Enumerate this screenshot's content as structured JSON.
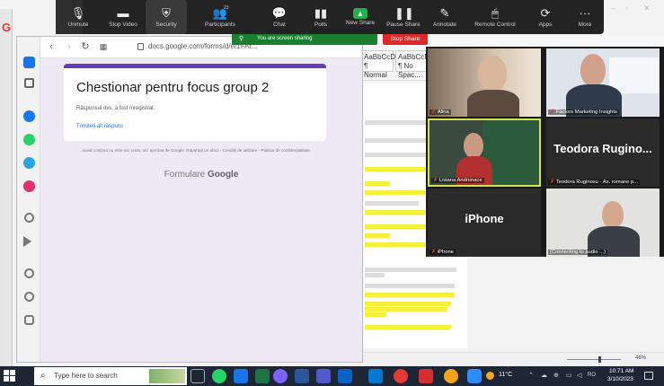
{
  "zoom_toolbar": {
    "logo": "G",
    "participant_count": "23",
    "items": [
      {
        "label": "Unmute",
        "icon": "mic-muted-icon"
      },
      {
        "label": "Stop Video",
        "icon": "video-icon"
      },
      {
        "label": "Security",
        "icon": "shield-icon"
      },
      {
        "label": "Participants",
        "icon": "participants-icon"
      },
      {
        "label": "Chat",
        "icon": "chat-icon"
      },
      {
        "label": "Polls",
        "icon": "polls-icon"
      },
      {
        "label": "New Share",
        "icon": "share-icon"
      },
      {
        "label": "Pause Share",
        "icon": "pause-icon"
      },
      {
        "label": "Annotate",
        "icon": "pen-icon"
      },
      {
        "label": "Remote Control",
        "icon": "mouse-icon"
      },
      {
        "label": "Apps",
        "icon": "apps-icon"
      },
      {
        "label": "More",
        "icon": "more-icon"
      }
    ],
    "sharing_text": "You are screen sharing",
    "stop_share_label": "Stop Share"
  },
  "browser": {
    "url": "docs.google.com/forms/d/e/1FAI..."
  },
  "form": {
    "title": "Chestionar pentru focus group 2",
    "confirmation": "Răspunsul dvs. a fost înregistrat.",
    "another_response": "Trimiteți alt răspuns",
    "disclaimer": "Acest conținut nu este nici creat, nici aprobat de Google. Raportați un abuz - Condiții de utilizare - Politica de confidențialitate",
    "footer_brand_prefix": "Formulare",
    "footer_brand": "Google"
  },
  "word": {
    "styles": [
      {
        "sample": "AaBbCcDc",
        "name": "¶ Normal"
      },
      {
        "sample": "AaBbCcDc",
        "name": "¶ No Spac..."
      }
    ],
    "zoom": "46%"
  },
  "gallery": {
    "tiles": [
      {
        "name": "Alina",
        "kind": "video"
      },
      {
        "name": "Factors Marketing Insights",
        "kind": "video"
      },
      {
        "name": "Liviana Andronace",
        "kind": "video"
      },
      {
        "name": "Teodora Ruginosu - As. romane p...",
        "kind": "name",
        "big": "Teodora Rugino..."
      },
      {
        "name": "iPhone",
        "kind": "name",
        "big": "iPhone"
      },
      {
        "name": "(Connecting to audio ...)",
        "kind": "video"
      }
    ]
  },
  "taskbar": {
    "search_placeholder": "Type here to search",
    "weather": "11°C",
    "language": "RO",
    "time": "10:71 AM",
    "date": "3/10/2023"
  },
  "colors": {
    "form_accent": "#673ab7",
    "zoom_share_green": "#1a7f2f",
    "stop_share_red": "#e02828",
    "highlight": "#f5f03a"
  }
}
